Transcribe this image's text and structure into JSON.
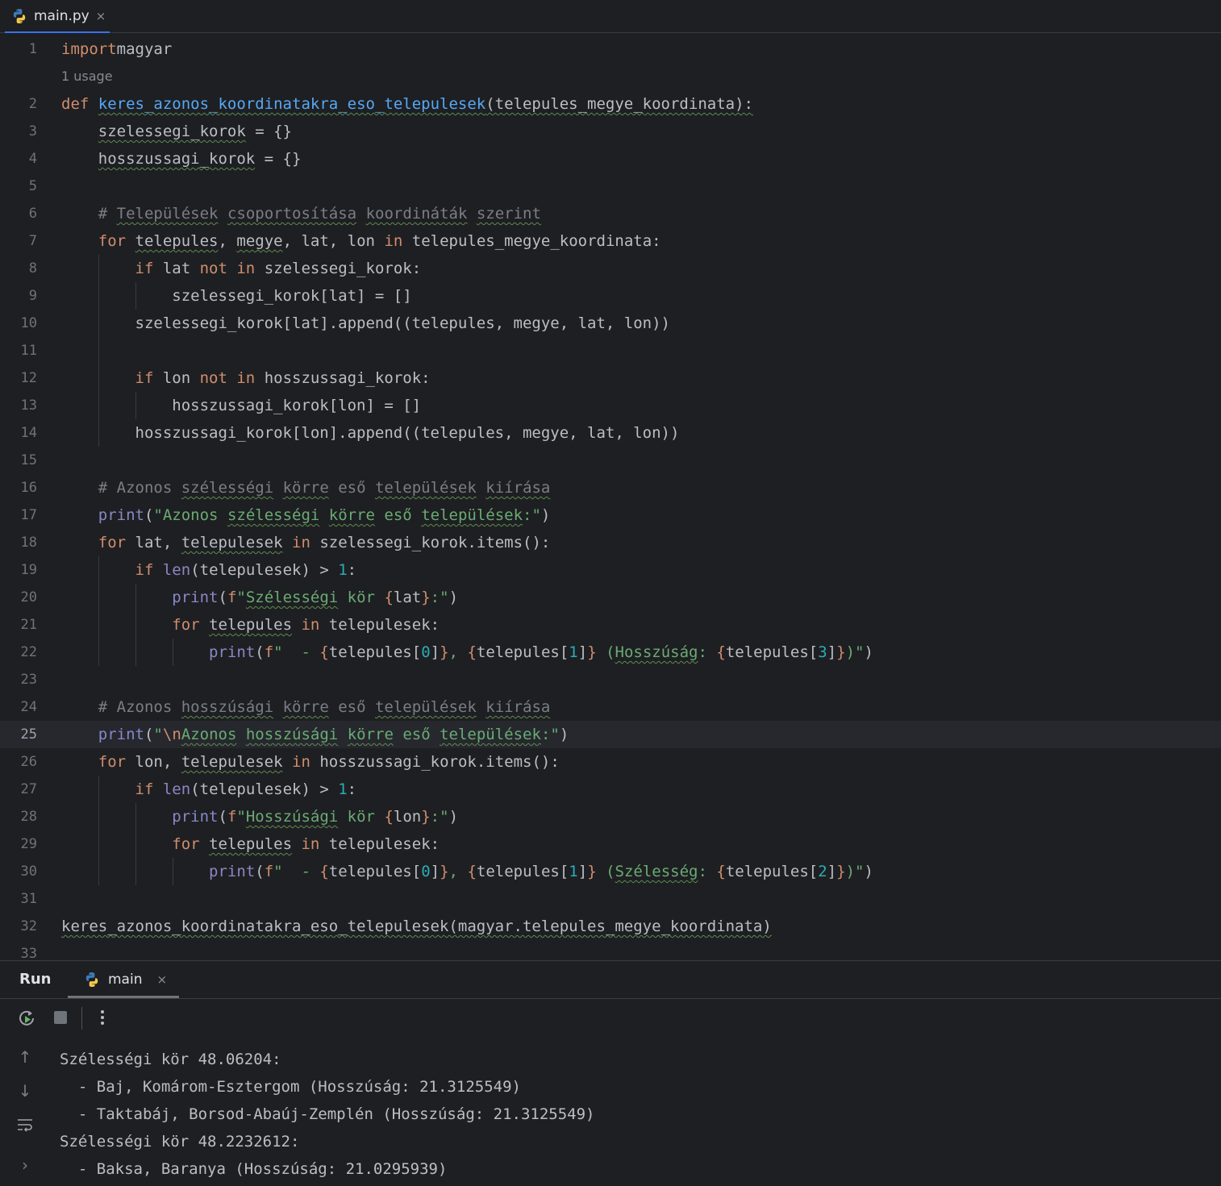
{
  "tab": {
    "filename": "main.py",
    "close": "×"
  },
  "editor": {
    "usage_hint": "1 usage",
    "current_line": 25,
    "lines": [
      {
        "n": "1",
        "code": [
          [
            "kw",
            "import"
          ],
          [
            "",
            "magyar"
          ]
        ]
      },
      {
        "n": "2",
        "code": [
          [
            "kw",
            "def"
          ],
          [
            "",
            " "
          ],
          [
            "fn sq",
            "keres_azonos_koordinatakra_eso_telepulesek"
          ],
          [
            "sq",
            "(telepules_megye_koordinata):"
          ]
        ]
      },
      {
        "n": "3",
        "code": [
          [
            "",
            "    "
          ],
          [
            "sq",
            "szelessegi_korok"
          ],
          [
            "",
            " = {}"
          ]
        ]
      },
      {
        "n": "4",
        "code": [
          [
            "",
            "    "
          ],
          [
            "sq",
            "hosszussagi_korok"
          ],
          [
            "",
            " = {}"
          ]
        ]
      },
      {
        "n": "5",
        "code": []
      },
      {
        "n": "6",
        "code": [
          [
            "",
            "    "
          ],
          [
            "cmt",
            "# "
          ],
          [
            "cmt sq",
            "Települések"
          ],
          [
            "cmt",
            " "
          ],
          [
            "cmt sq",
            "csoportosítása"
          ],
          [
            "cmt",
            " "
          ],
          [
            "cmt sq",
            "koordináták"
          ],
          [
            "cmt",
            " "
          ],
          [
            "cmt sq",
            "szerint"
          ]
        ]
      },
      {
        "n": "7",
        "code": [
          [
            "",
            "    "
          ],
          [
            "kw",
            "for"
          ],
          [
            "",
            " "
          ],
          [
            "sq",
            "telepules"
          ],
          [
            ", "
          ],
          [
            "sq",
            "megye"
          ],
          [
            "",
            ", lat, lon "
          ],
          [
            "kw",
            "in"
          ],
          [
            "",
            " telepules_megye_koordinata:"
          ]
        ]
      },
      {
        "n": "8",
        "code": [
          [
            "",
            "        "
          ],
          [
            "kw",
            "if"
          ],
          [
            "",
            " lat "
          ],
          [
            "kw",
            "not in"
          ],
          [
            "",
            " szelessegi_korok:"
          ]
        ]
      },
      {
        "n": "9",
        "code": [
          [
            "",
            "            szelessegi_korok[lat] = []"
          ]
        ]
      },
      {
        "n": "10",
        "code": [
          [
            "",
            "        szelessegi_korok[lat].append((telepules, megye, lat, lon))"
          ]
        ]
      },
      {
        "n": "11",
        "code": []
      },
      {
        "n": "12",
        "code": [
          [
            "",
            "        "
          ],
          [
            "kw",
            "if"
          ],
          [
            "",
            " lon "
          ],
          [
            "kw",
            "not in"
          ],
          [
            "",
            " hosszussagi_korok:"
          ]
        ]
      },
      {
        "n": "13",
        "code": [
          [
            "",
            "            hosszussagi_korok[lon] = []"
          ]
        ]
      },
      {
        "n": "14",
        "code": [
          [
            "",
            "        hosszussagi_korok[lon].append((telepules, megye, lat, lon))"
          ]
        ]
      },
      {
        "n": "15",
        "code": []
      },
      {
        "n": "16",
        "code": [
          [
            "",
            "    "
          ],
          [
            "cmt",
            "# Azonos "
          ],
          [
            "cmt sq",
            "szélességi"
          ],
          [
            "cmt",
            " "
          ],
          [
            "cmt sq",
            "körre"
          ],
          [
            "cmt",
            " eső "
          ],
          [
            "cmt sq",
            "települések"
          ],
          [
            "cmt",
            " "
          ],
          [
            "cmt sq",
            "kiírása"
          ]
        ]
      },
      {
        "n": "17",
        "code": [
          [
            "",
            "    "
          ],
          [
            "bi",
            "print"
          ],
          [
            "",
            "("
          ],
          [
            "str",
            "\"Azonos "
          ],
          [
            "str sq",
            "szélességi"
          ],
          [
            "str",
            " "
          ],
          [
            "str sq",
            "körre"
          ],
          [
            "str",
            " eső "
          ],
          [
            "str sq",
            "települések"
          ],
          [
            "str",
            ":\""
          ],
          [
            "",
            ")"
          ]
        ]
      },
      {
        "n": "18",
        "code": [
          [
            "",
            "    "
          ],
          [
            "kw",
            "for"
          ],
          [
            "",
            " lat, "
          ],
          [
            "sq",
            "telepulesek"
          ],
          [
            "",
            " "
          ],
          [
            "kw",
            "in"
          ],
          [
            "",
            " szelessegi_korok.items():"
          ]
        ]
      },
      {
        "n": "19",
        "code": [
          [
            "",
            "        "
          ],
          [
            "kw",
            "if"
          ],
          [
            "",
            " "
          ],
          [
            "bi",
            "len"
          ],
          [
            "",
            "(telepulesek) > "
          ],
          [
            "num",
            "1"
          ],
          [
            "",
            ":"
          ]
        ]
      },
      {
        "n": "20",
        "code": [
          [
            "",
            "            "
          ],
          [
            "bi",
            "print"
          ],
          [
            "",
            "("
          ],
          [
            "kw",
            "f"
          ],
          [
            "str",
            "\""
          ],
          [
            "str sq",
            "Szélességi"
          ],
          [
            "str",
            " kör "
          ],
          [
            "kw",
            "{"
          ],
          [
            "",
            "lat"
          ],
          [
            "kw",
            "}"
          ],
          [
            "str",
            ":\""
          ],
          [
            "",
            ")"
          ]
        ]
      },
      {
        "n": "21",
        "code": [
          [
            "",
            "            "
          ],
          [
            "kw",
            "for"
          ],
          [
            "",
            " "
          ],
          [
            "sq",
            "telepules"
          ],
          [
            "",
            " "
          ],
          [
            "kw",
            "in"
          ],
          [
            "",
            " telepulesek:"
          ]
        ]
      },
      {
        "n": "22",
        "code": [
          [
            "",
            "                "
          ],
          [
            "bi",
            "print"
          ],
          [
            "",
            "("
          ],
          [
            "kw",
            "f"
          ],
          [
            "str",
            "\"  - "
          ],
          [
            "kw",
            "{"
          ],
          [
            "",
            "telepules["
          ],
          [
            "num",
            "0"
          ],
          [
            "",
            "]"
          ],
          [
            "kw",
            "}"
          ],
          [
            "str",
            ", "
          ],
          [
            "kw",
            "{"
          ],
          [
            "",
            "telepules["
          ],
          [
            "num",
            "1"
          ],
          [
            "",
            "]"
          ],
          [
            "kw",
            "}"
          ],
          [
            "str",
            " ("
          ],
          [
            "str sq",
            "Hosszúság"
          ],
          [
            "str",
            ": "
          ],
          [
            "kw",
            "{"
          ],
          [
            "",
            "telepules["
          ],
          [
            "num",
            "3"
          ],
          [
            "",
            "]"
          ],
          [
            "kw",
            "}"
          ],
          [
            "str",
            ")\""
          ],
          [
            "",
            ")"
          ]
        ]
      },
      {
        "n": "23",
        "code": []
      },
      {
        "n": "24",
        "code": [
          [
            "",
            "    "
          ],
          [
            "cmt",
            "# Azonos "
          ],
          [
            "cmt sq",
            "hosszúsági"
          ],
          [
            "cmt",
            " "
          ],
          [
            "cmt sq",
            "körre"
          ],
          [
            "cmt",
            " eső "
          ],
          [
            "cmt sq",
            "települések"
          ],
          [
            "cmt",
            " "
          ],
          [
            "cmt sq",
            "kiírása"
          ]
        ]
      },
      {
        "n": "25",
        "code": [
          [
            "",
            "    "
          ],
          [
            "bi",
            "print"
          ],
          [
            "",
            "("
          ],
          [
            "str",
            "\""
          ],
          [
            "kw",
            "\\n"
          ],
          [
            "str sq",
            "Azonos"
          ],
          [
            "str",
            " "
          ],
          [
            "str sq",
            "hosszúsági"
          ],
          [
            "str",
            " "
          ],
          [
            "str sq",
            "körre"
          ],
          [
            "str",
            " eső "
          ],
          [
            "str sq",
            "települések"
          ],
          [
            "str",
            ":\""
          ],
          [
            "",
            ")"
          ]
        ]
      },
      {
        "n": "26",
        "code": [
          [
            "",
            "    "
          ],
          [
            "kw",
            "for"
          ],
          [
            "",
            " lon, "
          ],
          [
            "sq",
            "telepulesek"
          ],
          [
            "",
            " "
          ],
          [
            "kw",
            "in"
          ],
          [
            "",
            " hosszussagi_korok.items():"
          ]
        ]
      },
      {
        "n": "27",
        "code": [
          [
            "",
            "        "
          ],
          [
            "kw",
            "if"
          ],
          [
            "",
            " "
          ],
          [
            "bi",
            "len"
          ],
          [
            "",
            "(telepulesek) > "
          ],
          [
            "num",
            "1"
          ],
          [
            "",
            ":"
          ]
        ]
      },
      {
        "n": "28",
        "code": [
          [
            "",
            "            "
          ],
          [
            "bi",
            "print"
          ],
          [
            "",
            "("
          ],
          [
            "kw",
            "f"
          ],
          [
            "str",
            "\""
          ],
          [
            "str sq",
            "Hosszúsági"
          ],
          [
            "str",
            " kör "
          ],
          [
            "kw",
            "{"
          ],
          [
            "",
            "lon"
          ],
          [
            "kw",
            "}"
          ],
          [
            "str",
            ":\""
          ],
          [
            "",
            ")"
          ]
        ]
      },
      {
        "n": "29",
        "code": [
          [
            "",
            "            "
          ],
          [
            "kw",
            "for"
          ],
          [
            "",
            " "
          ],
          [
            "sq",
            "telepules"
          ],
          [
            "",
            " "
          ],
          [
            "kw",
            "in"
          ],
          [
            "",
            " telepulesek:"
          ]
        ]
      },
      {
        "n": "30",
        "code": [
          [
            "",
            "                "
          ],
          [
            "bi",
            "print"
          ],
          [
            "",
            "("
          ],
          [
            "kw",
            "f"
          ],
          [
            "str",
            "\"  - "
          ],
          [
            "kw",
            "{"
          ],
          [
            "",
            "telepules["
          ],
          [
            "num",
            "0"
          ],
          [
            "",
            "]"
          ],
          [
            "kw",
            "}"
          ],
          [
            "str",
            ", "
          ],
          [
            "kw",
            "{"
          ],
          [
            "",
            "telepules["
          ],
          [
            "num",
            "1"
          ],
          [
            "",
            "]"
          ],
          [
            "kw",
            "}"
          ],
          [
            "str",
            " ("
          ],
          [
            "str sq",
            "Szélesség"
          ],
          [
            "str",
            ": "
          ],
          [
            "kw",
            "{"
          ],
          [
            "",
            "telepules["
          ],
          [
            "num",
            "2"
          ],
          [
            "",
            "]"
          ],
          [
            "kw",
            "}"
          ],
          [
            "str",
            ")\""
          ],
          [
            "",
            ")"
          ]
        ]
      },
      {
        "n": "31",
        "code": []
      },
      {
        "n": "32",
        "code": [
          [
            "sq",
            "keres_azonos_koordinatakra_eso_telepulesek(magyar.telepules_megye_koordinata)"
          ]
        ]
      },
      {
        "n": "33",
        "code": []
      }
    ]
  },
  "run": {
    "title": "Run",
    "tab_label": "main",
    "tab_close": "×",
    "output": [
      "Szélességi kör 48.06204:",
      "  - Baj, Komárom-Esztergom (Hosszúság: 21.3125549)",
      "  - Taktabáj, Borsod-Abaúj-Zemplén (Hosszúság: 21.3125549)",
      "Szélességi kör 48.2232612:",
      "  - Baksa, Baranya (Hosszúság: 21.0295939)"
    ]
  },
  "icons": {
    "rerun": "rerun-icon",
    "stop": "stop-icon",
    "more": "more-vertical-icon",
    "up": "arrow-up-icon",
    "down": "arrow-down-icon",
    "wrap": "soft-wrap-icon",
    "expand": "chevron-right-icon"
  }
}
